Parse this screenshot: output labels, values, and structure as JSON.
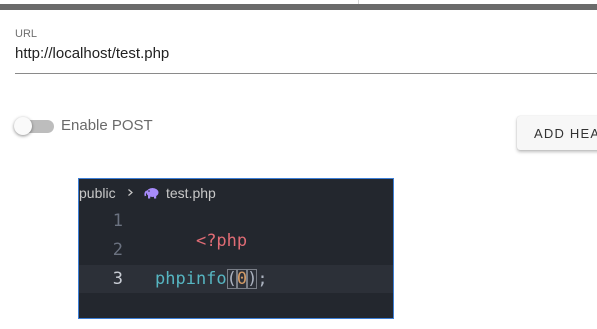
{
  "form": {
    "url_label": "URL",
    "url_value": "http://localhost/test.php",
    "enable_post_label": "Enable POST",
    "enable_post_on": false,
    "add_header_label": "ADD HEA"
  },
  "editor": {
    "breadcrumb": {
      "folder": "public",
      "file": "test.php",
      "file_icon": "php-elephant-icon"
    },
    "lines": [
      {
        "number": "1",
        "tokens": [
          "<?php"
        ]
      },
      {
        "number": "2",
        "tokens": []
      },
      {
        "number": "3",
        "tokens": [
          "phpinfo",
          "(",
          "0",
          ")",
          ";"
        ]
      }
    ],
    "active_line": "3"
  },
  "colors": {
    "editor_background": "#23272e",
    "editor_border": "#3d7fd6",
    "php_tag": "#e06c75",
    "function": "#56b6c2",
    "number": "#d19a66"
  }
}
